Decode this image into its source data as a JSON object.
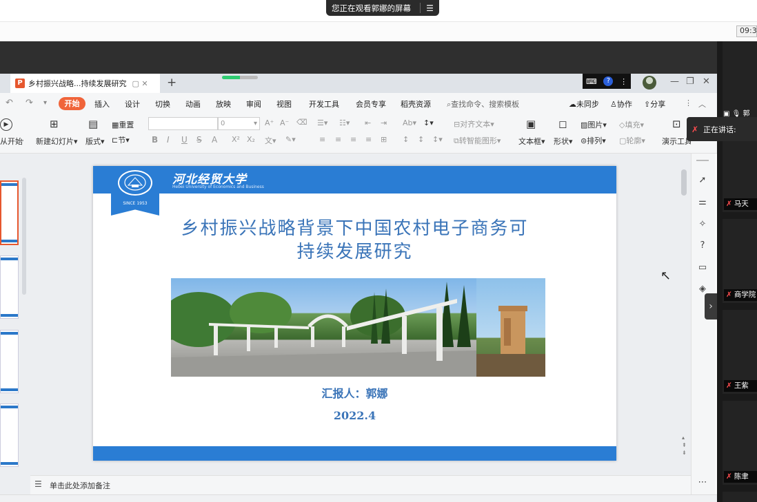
{
  "screen_share": {
    "banner_text": "您正在观看郭娜的屏幕",
    "menu_icon": "list-icon",
    "clock": "09:3"
  },
  "wps": {
    "tab_title": "乡村振兴战略...持续发展研究",
    "tab_icon": "ppt-icon",
    "new_tab": "+",
    "window_controls": [
      "—",
      "❐",
      "✕"
    ],
    "menu": {
      "active": "开始",
      "items": [
        "插入",
        "设计",
        "切换",
        "动画",
        "放映",
        "审阅",
        "视图",
        "开发工具",
        "会员专享",
        "稻壳资源"
      ],
      "search_placeholder": "查找命令、搜索模板",
      "right_items": [
        "未同步",
        "协作",
        "分享"
      ]
    },
    "ribbon": {
      "play_from_start": "从开始",
      "new_slide": "新建幻灯片",
      "layout": "版式",
      "reset": "重置",
      "section": "节",
      "font_size_value": "0",
      "align_text": "对齐文本",
      "to_smartart": "转智能图形",
      "textbox": "文本框",
      "shape": "形状",
      "picture": "图片",
      "arrange": "排列",
      "fill": "填充",
      "outline": "轮廓",
      "presentation_tools": "演示工具",
      "format_buttons": [
        "B",
        "I",
        "U",
        "S",
        "A",
        "X²",
        "X₂"
      ]
    },
    "notes_placeholder": "单击此处添加备注"
  },
  "slide": {
    "university_cn": "河北经贸大学",
    "university_en": "Hebei University of Economics and Business",
    "since": "SINCE 1953",
    "title_line1": "乡村振兴战略背景下中国农村电子商务可",
    "title_line2": "持续发展研究",
    "reporter": "汇报人：郭娜",
    "date": "2022.4"
  },
  "meeting": {
    "speaking_label": "正在讲话:",
    "top_tile_label": "郭",
    "participants": [
      "马天",
      "商学院",
      "王紫",
      "陈聿"
    ]
  },
  "colors": {
    "slide_blue": "#2a7dd4",
    "title_blue": "#3a74b8",
    "accent_orange": "#f0643a"
  }
}
